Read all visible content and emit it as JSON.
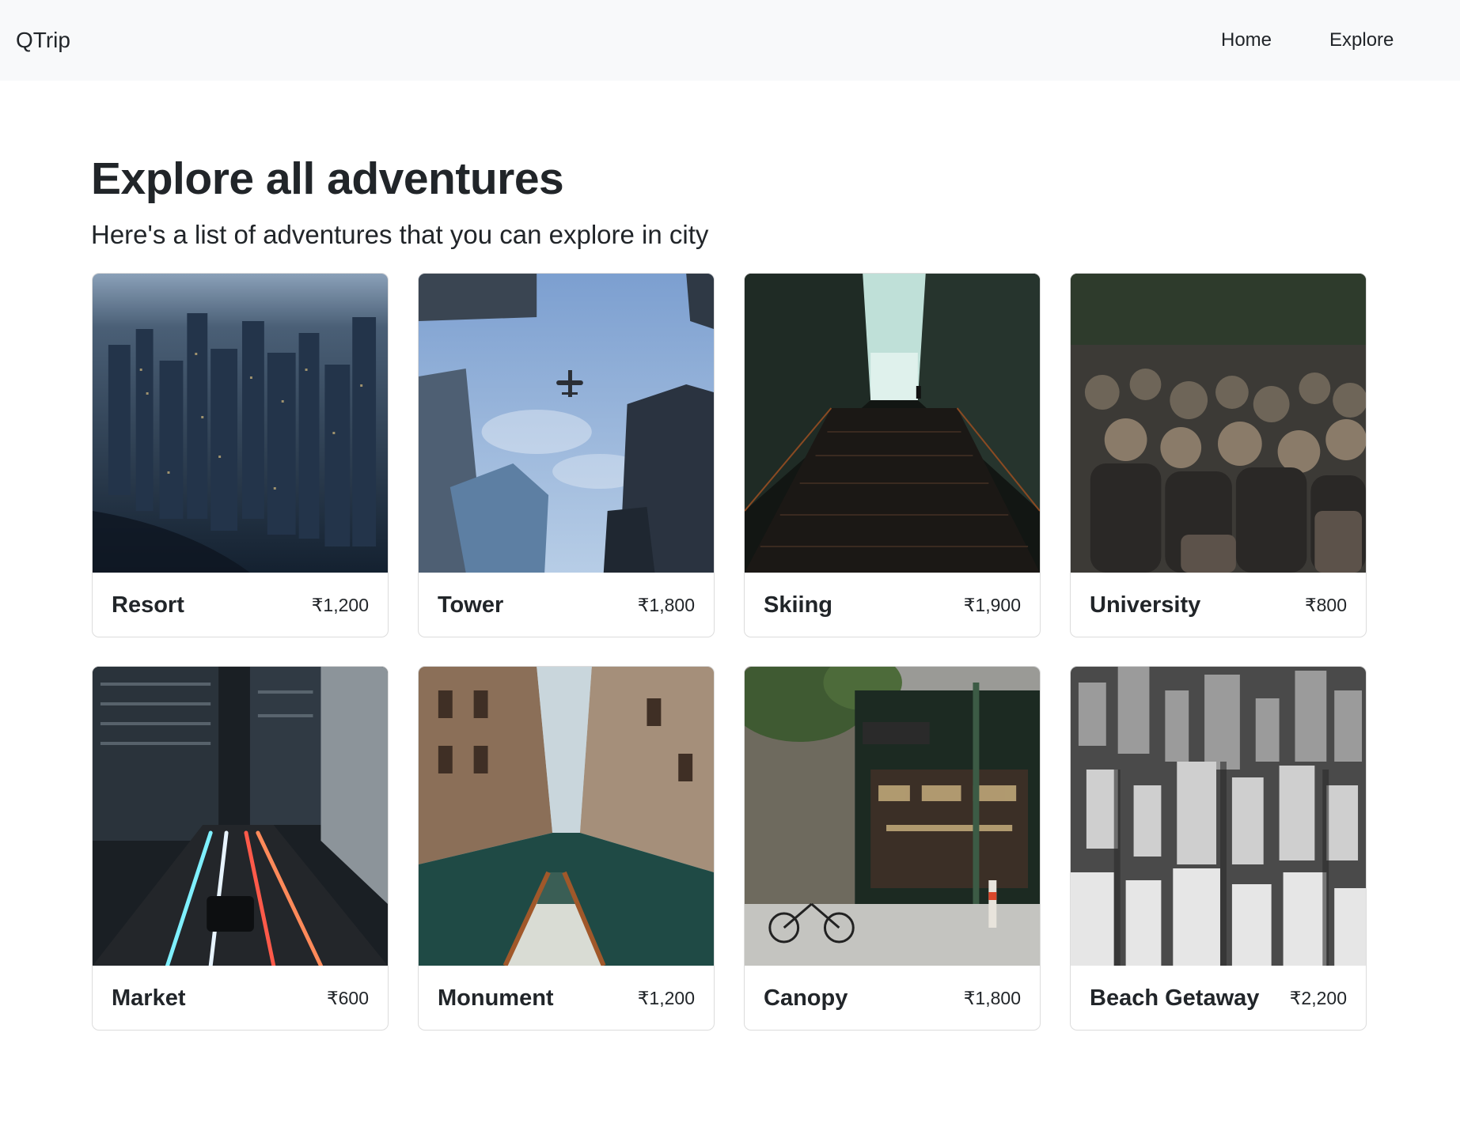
{
  "navbar": {
    "brand": "QTrip",
    "links": [
      {
        "label": "Home"
      },
      {
        "label": "Explore"
      }
    ]
  },
  "page": {
    "title": "Explore all adventures",
    "subtitle": "Here's a list of adventures that you can explore in city"
  },
  "adventures": [
    {
      "name": "Resort",
      "price": "₹1,200",
      "image": "night-city-aerial-photo"
    },
    {
      "name": "Tower",
      "price": "₹1,800",
      "image": "skyscrapers-airplane-photo"
    },
    {
      "name": "Skiing",
      "price": "₹1,900",
      "image": "dark-staircase-photo"
    },
    {
      "name": "University",
      "price": "₹800",
      "image": "crowd-street-photo"
    },
    {
      "name": "Market",
      "price": "₹600",
      "image": "night-traffic-street-photo"
    },
    {
      "name": "Monument",
      "price": "₹1,200",
      "image": "canal-boat-photo"
    },
    {
      "name": "Canopy",
      "price": "₹1,800",
      "image": "bakery-storefront-photo"
    },
    {
      "name": "Beach Getaway",
      "price": "₹2,200",
      "image": "monochrome-skyline-photo"
    }
  ]
}
